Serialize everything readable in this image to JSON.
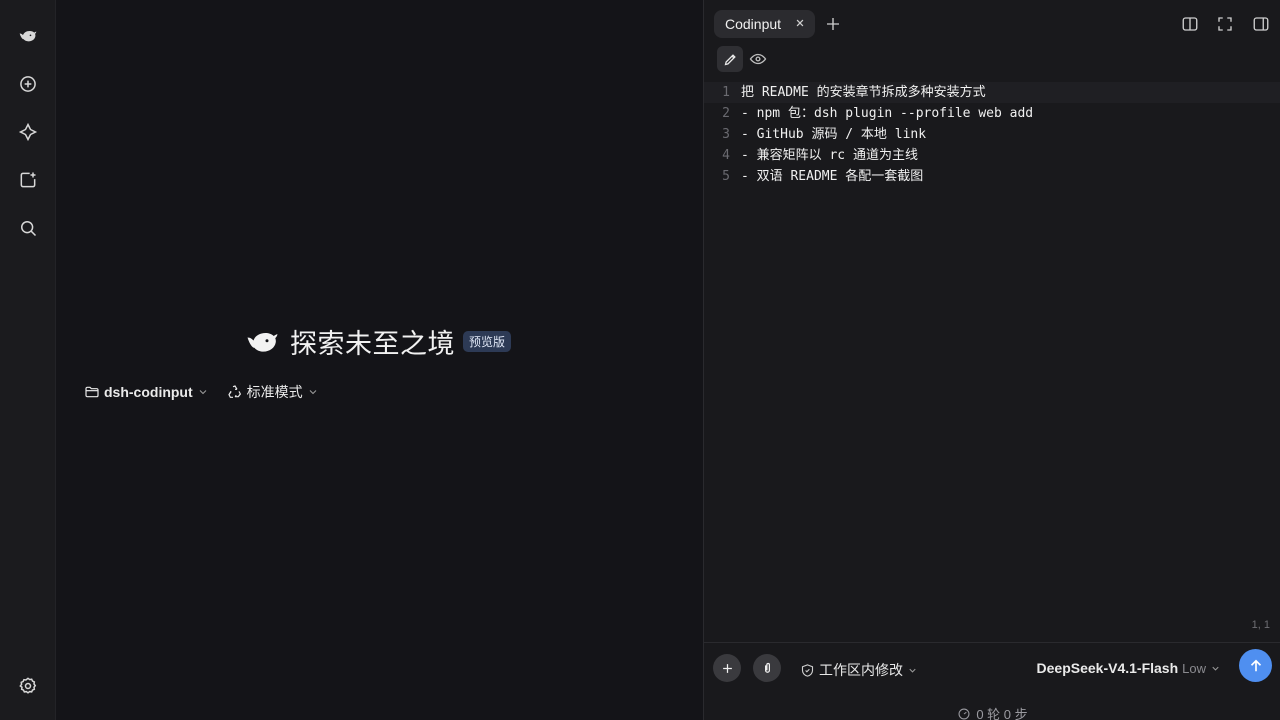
{
  "sidebar": {
    "items": [
      {
        "icon": "deepseek-logo-icon"
      },
      {
        "icon": "new-chat-icon"
      },
      {
        "icon": "explore-icon"
      },
      {
        "icon": "add-workspace-icon"
      },
      {
        "icon": "search-icon"
      },
      {
        "icon": "settings-icon"
      }
    ]
  },
  "main": {
    "hero_title": "探索未至之境",
    "hero_badge": "预览版",
    "project_selector": "dsh-codinput",
    "mode_selector": "标准模式"
  },
  "panel": {
    "tab_label": "Codinput",
    "editor_lines": [
      {
        "num": "1",
        "text": "把 README 的安装章节拆成多种安装方式"
      },
      {
        "num": "2",
        "text": "- npm 包：dsh plugin --profile web add"
      },
      {
        "num": "3",
        "text": "- GitHub 源码 / 本地 link"
      },
      {
        "num": "4",
        "text": "- 兼容矩阵以 rc 通道为主线"
      },
      {
        "num": "5",
        "text": "- 双语 README 各配一套截图"
      }
    ],
    "cursor_position": "1, 1",
    "permission_label": "工作区内修改",
    "model_name": "DeepSeek-V4.1-Flash",
    "model_effort": "Low",
    "stats": "0 轮 0 步"
  },
  "colors": {
    "accent": "#4f8ff0",
    "background": "#141418",
    "panel_background": "#19191c",
    "badge_background": "#2d3a55"
  }
}
